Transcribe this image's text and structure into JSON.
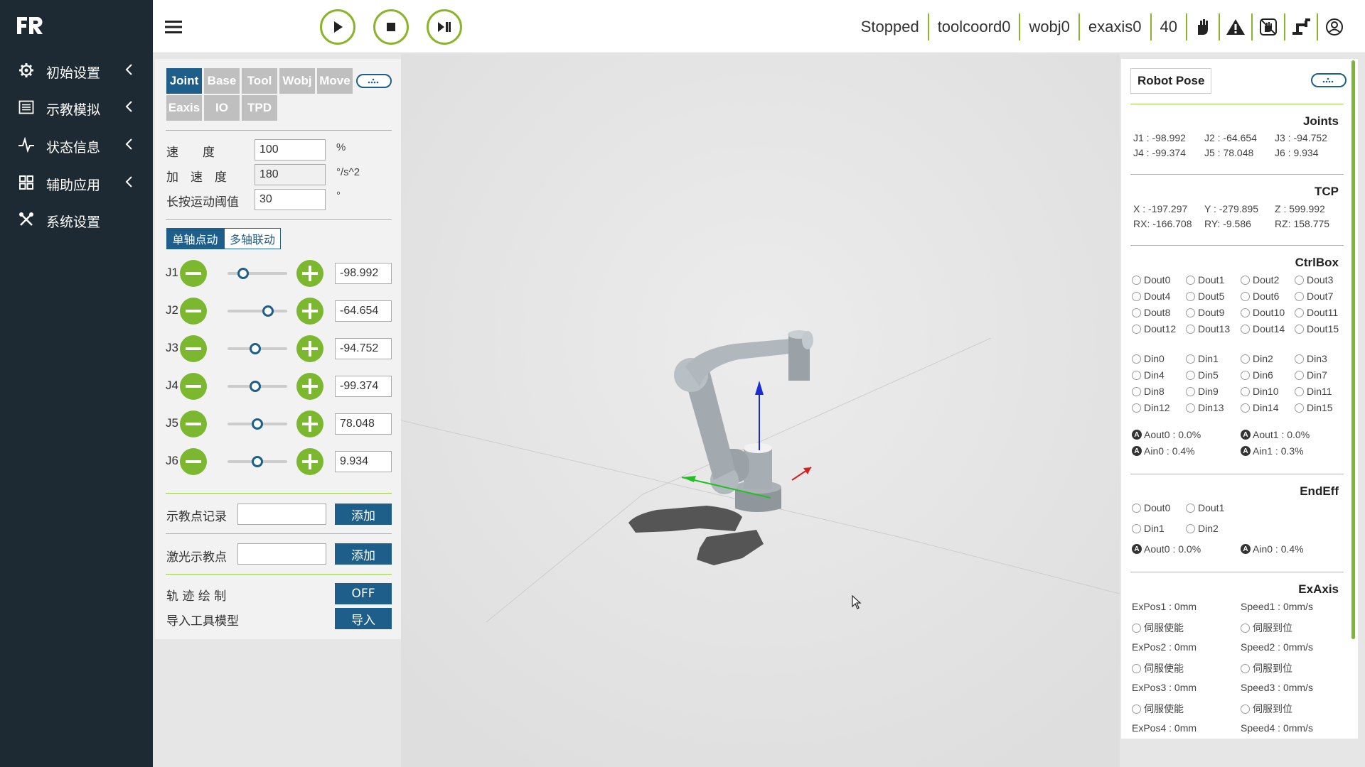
{
  "sidebar": {
    "items": [
      {
        "label": "初始设置",
        "icon": "gear-icon"
      },
      {
        "label": "示教模拟",
        "icon": "list-icon"
      },
      {
        "label": "状态信息",
        "icon": "pulse-icon"
      },
      {
        "label": "辅助应用",
        "icon": "grid-icon"
      },
      {
        "label": "系统设置",
        "icon": "tools-icon"
      }
    ]
  },
  "topbar": {
    "status": "Stopped",
    "tool": "toolcoord0",
    "wobj": "wobj0",
    "exaxis": "exaxis0",
    "speed": "40"
  },
  "left": {
    "tabs": [
      "Joint",
      "Base",
      "Tool",
      "Wobj",
      "Move",
      "Eaxis",
      "IO",
      "TPD"
    ],
    "speed_label": "速　　度",
    "speed_value": "100",
    "speed_unit": "%",
    "acc_label": "加　速　度",
    "acc_value": "180",
    "acc_unit": "°/s^2",
    "threshold_label": "长按运动阈值",
    "threshold_value": "30",
    "threshold_unit": "°",
    "mode_single": "单轴点动",
    "mode_multi": "多轴联动",
    "joints": [
      {
        "name": "J1",
        "value": "-98.992",
        "level": 0.26
      },
      {
        "name": "J2",
        "value": "-64.654",
        "level": 0.68
      },
      {
        "name": "J3",
        "value": "-94.752",
        "level": 0.46
      },
      {
        "name": "J4",
        "value": "-99.374",
        "level": 0.46
      },
      {
        "name": "J5",
        "value": "78.048",
        "level": 0.5
      },
      {
        "name": "J6",
        "value": "9.934",
        "level": 0.5
      }
    ],
    "teach_label": "示教点记录",
    "laser_label": "激光示教点",
    "add": "添加",
    "track_label": "轨 迹 绘 制",
    "track_value": "OFF",
    "import_label": "导入工具模型",
    "import_btn": "导入"
  },
  "right": {
    "title": "Robot Pose",
    "joints_title": "Joints",
    "joints_row1": [
      "J1 : -98.992",
      "J2 : -64.654",
      "J3 : -94.752"
    ],
    "joints_row2": [
      "J4 : -99.374",
      "J5 : 78.048",
      "J6 : 9.934"
    ],
    "tcp_title": "TCP",
    "tcp_row1": [
      "X  : -197.297",
      "Y  : -279.895",
      "Z  : 599.992"
    ],
    "tcp_row2": [
      "RX: -166.708",
      "RY: -9.586",
      "RZ: 158.775"
    ],
    "ctrlbox_title": "CtrlBox",
    "dout": [
      "Dout0",
      "Dout1",
      "Dout2",
      "Dout3",
      "Dout4",
      "Dout5",
      "Dout6",
      "Dout7",
      "Dout8",
      "Dout9",
      "Dout10",
      "Dout11",
      "Dout12",
      "Dout13",
      "Dout14",
      "Dout15"
    ],
    "din": [
      "Din0",
      "Din1",
      "Din2",
      "Din3",
      "Din4",
      "Din5",
      "Din6",
      "Din7",
      "Din8",
      "Din9",
      "Din10",
      "Din11",
      "Din12",
      "Din13",
      "Din14",
      "Din15"
    ],
    "analog": [
      "Aout0 :  0.0%",
      "Aout1 :  0.0%",
      "Ain0   :  0.4%",
      "Ain1   :  0.3%"
    ],
    "endeff_title": "EndEff",
    "endeff_io": [
      "Dout0",
      "Dout1",
      "Din1",
      "Din2"
    ],
    "endeff_analog": [
      "Aout0 :  0.0%",
      "Ain0   :  0.4%"
    ],
    "exaxis_title": "ExAxis",
    "exaxis": [
      {
        "pos": "ExPos1 :  0mm",
        "speed": "Speed1 :  0mm/s"
      },
      {
        "pos": "ExPos2 :  0mm",
        "speed": "Speed2 :  0mm/s"
      },
      {
        "pos": "ExPos3 :  0mm",
        "speed": "Speed3 :  0mm/s"
      },
      {
        "pos": "ExPos4 :  0mm",
        "speed": "Speed4 :  0mm/s"
      }
    ],
    "servo_enable": "伺服使能",
    "servo_ready": "伺服到位"
  }
}
